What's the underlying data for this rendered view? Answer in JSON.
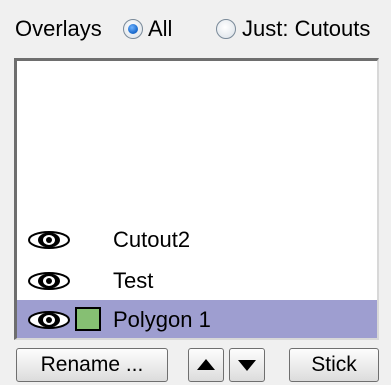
{
  "header": {
    "overlays_label": "Overlays",
    "radio_all_label": "All",
    "radio_just_label": "Just: Cutouts",
    "selected": "All"
  },
  "list": {
    "items": [
      {
        "label": "Cutout2",
        "visible": true,
        "has_swatch": false
      },
      {
        "label": "Test",
        "visible": true,
        "has_swatch": false
      },
      {
        "label": "Polygon 1",
        "visible": true,
        "has_swatch": true,
        "swatch_color": "#86bf73",
        "selected": true
      }
    ],
    "selection_color": "#9e9ed0"
  },
  "buttons": {
    "rename_label": "Rename ...",
    "stick_label": "Stick",
    "move_up_icon": "triangle-up-icon",
    "move_down_icon": "triangle-down-icon"
  }
}
